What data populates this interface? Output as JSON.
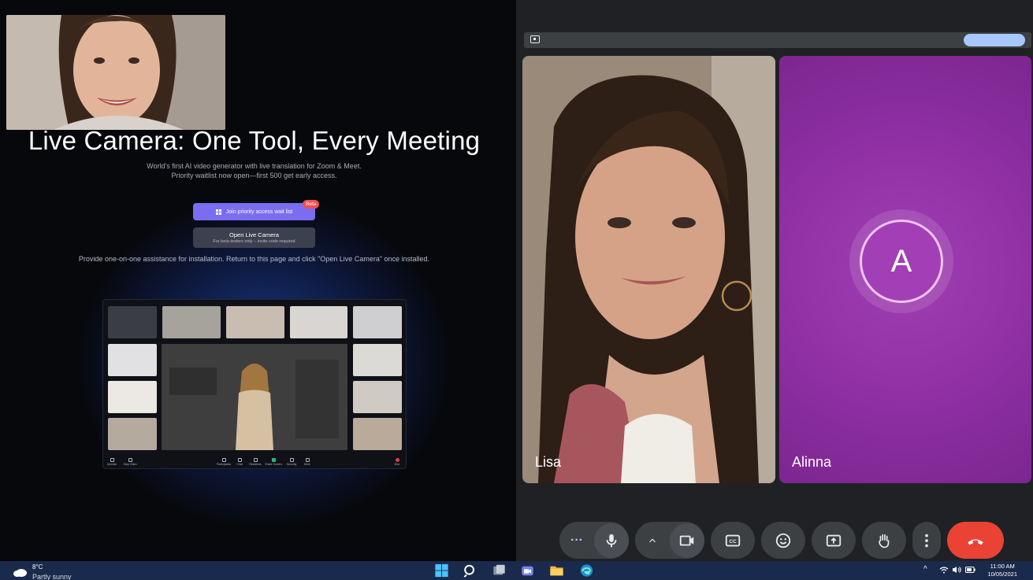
{
  "left_page": {
    "hero_title": "Live Camera: One Tool, Every Meeting",
    "subtitle_line1": "World's first AI video generator with live translation for Zoom & Meet.",
    "subtitle_line2": "Priority waitlist now open—first 500 get early access.",
    "join_button": "Join priority access wait list",
    "beta_badge": "Beta",
    "open_button_title": "Open Live Camera",
    "open_button_note": "For beta testers only – invite code required",
    "assist_text": "Provide one-on-one assistance for installation. Return to this page and click \"Open Live Camera\" once installed.",
    "mock_toolbar": {
      "left": [
        "Unmute",
        "Stop Video"
      ],
      "center": [
        "Participants",
        "Chat",
        "Reactions",
        "Share Screen",
        "Security",
        "More"
      ],
      "right": "End"
    }
  },
  "meeting": {
    "participants": [
      {
        "name": "Lisa"
      },
      {
        "name": "Alinna",
        "initial": "A"
      }
    ],
    "controls": [
      "more-options",
      "microphone",
      "camera-options",
      "camera",
      "captions",
      "emoji",
      "present",
      "raise-hand",
      "overflow-menu",
      "leave-call"
    ],
    "colors": {
      "background": "#202124",
      "control": "#3c4043",
      "leave": "#ea4335",
      "alinna_tile": "#9a38ad",
      "accent": "#a8c7fa"
    }
  },
  "taskbar": {
    "temperature": "8°C",
    "condition": "Partly sunny",
    "time": "11:00 AM",
    "date": "10/05/2021",
    "apps": [
      "windows-start",
      "search",
      "task-view",
      "teams",
      "file-explorer",
      "edge"
    ]
  }
}
